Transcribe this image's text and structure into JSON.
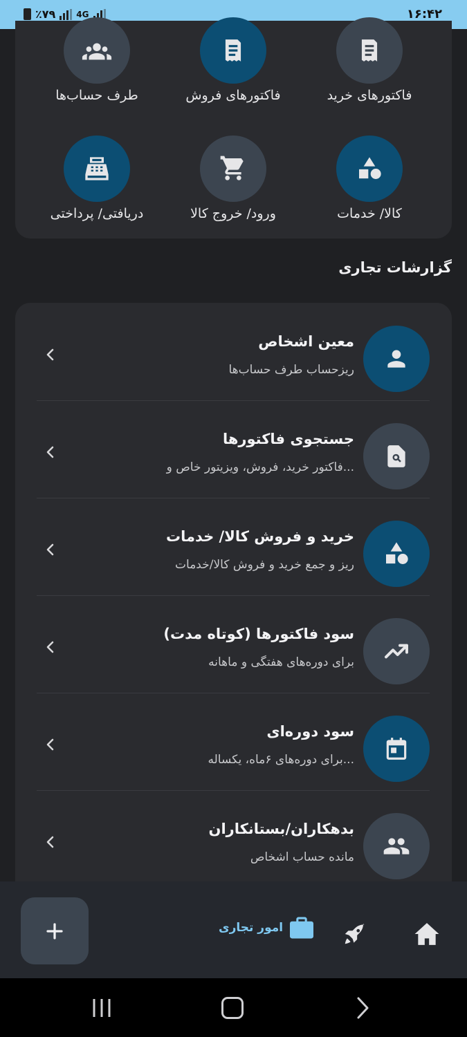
{
  "status_bar": {
    "time": "۱۶:۴۲",
    "battery": "٪۷۹",
    "network": "4G"
  },
  "quick_actions": [
    {
      "label": "فاکتورهای خرید",
      "icon": "receipt-icon"
    },
    {
      "label": "فاکتورهای فروش",
      "icon": "receipt-icon"
    },
    {
      "label": "طرف حساب‌ها",
      "icon": "groups-icon"
    },
    {
      "label": "کالا/ خدمات",
      "icon": "shapes-icon"
    },
    {
      "label": "ورود/ خروج کالا",
      "icon": "cart-icon"
    },
    {
      "label": "دریافتی/ پرداختی",
      "icon": "cash-register-icon"
    }
  ],
  "reports": {
    "title": "گزارشات تجاری",
    "items": [
      {
        "title": "معین اشخاص",
        "subtitle": "ریزحساب طرف حساب‌ها",
        "icon": "person-icon"
      },
      {
        "title": "جستجوی فاکتورها",
        "subtitle": "فاکتور خرید، فروش، ویزیتور خاص و...",
        "icon": "file-search-icon"
      },
      {
        "title": "خرید و فروش کالا/ خدمات",
        "subtitle": "ریز و جمع خرید و فروش کالا/خدمات",
        "icon": "shapes-icon"
      },
      {
        "title": "سود فاکتورها (کوتاه مدت)",
        "subtitle": "برای دوره‌های هفتگی و ماهانه",
        "icon": "trending-icon"
      },
      {
        "title": "سود دوره‌ای",
        "subtitle": "برای دوره‌های ۶ماه، یکساله...",
        "icon": "calendar-icon"
      },
      {
        "title": "بدهکاران/بستانکاران",
        "subtitle": "مانده حساب اشخاص",
        "icon": "people-icon"
      }
    ]
  },
  "bottom_nav": {
    "active_label": "امور تجاری"
  },
  "colors": {
    "accent": "#7fc8f0",
    "circle_blue": "#0c4e73",
    "circle_grey": "#3c4550",
    "status_bar": "#87ccf0"
  }
}
